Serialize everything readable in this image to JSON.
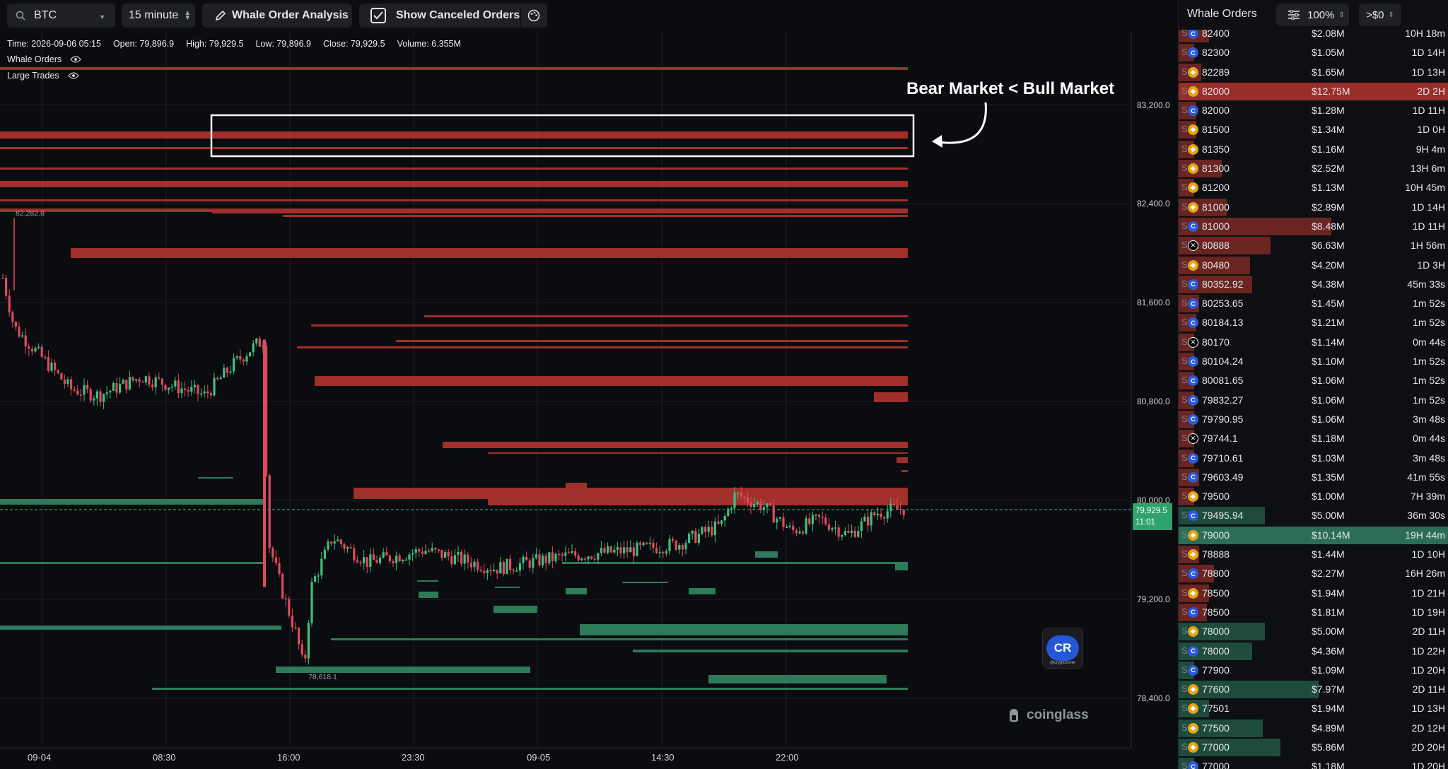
{
  "toolbar": {
    "symbol": "BTC",
    "interval": "15 minute",
    "whale_btn": "Whale Order Analysis",
    "canceled_btn": "Show Canceled Orders"
  },
  "info": {
    "time": "Time: 2026-09-06 05:15",
    "open": "Open: 79,896.9",
    "high": "High: 79,929.5",
    "low": "Low: 79,896.9",
    "close": "Close: 79,929.5",
    "volume": "Volume: 6.355M"
  },
  "legends": {
    "whale": "Whale Orders",
    "large": "Large Trades"
  },
  "annotation": "Bear Market < Bull Market",
  "axis": {
    "prices": [
      "83,200.0",
      "82,400.0",
      "81,600.0",
      "80,800.0",
      "80,000.0",
      "79,200.0",
      "78,400.0"
    ],
    "last_price": "79,929.5",
    "last_countdown": "11:01",
    "times": [
      "09-04",
      "08:30",
      "16:00",
      "23:30",
      "09-05",
      "14:30",
      "22:00"
    ],
    "max_label": "82,282.8",
    "min_label": "78,618.1"
  },
  "branding": {
    "logo": "coinglass",
    "badge": "CR",
    "badge_sub": "@cryptorover"
  },
  "panel": {
    "title": "Whale Orders",
    "percent": "100%",
    "min": ">$0",
    "rows": [
      {
        "side": "S",
        "ex": "C",
        "price": "82400",
        "amount": "$2.08M",
        "age": "10H 18m",
        "bar": 0.12
      },
      {
        "side": "S",
        "ex": "C",
        "price": "82300",
        "amount": "$1.05M",
        "age": "1D 14H",
        "bar": 0.06
      },
      {
        "side": "S",
        "ex": "B",
        "price": "82289",
        "amount": "$1.65M",
        "age": "1D 13H",
        "bar": 0.09
      },
      {
        "side": "S",
        "ex": "B",
        "price": "82000",
        "amount": "$12.75M",
        "age": "2D 2H",
        "bar": 1.0
      },
      {
        "side": "S",
        "ex": "C",
        "price": "82000",
        "amount": "$1.28M",
        "age": "1D 11H",
        "bar": 0.07
      },
      {
        "side": "S",
        "ex": "B",
        "price": "81500",
        "amount": "$1.34M",
        "age": "1D 0H",
        "bar": 0.07
      },
      {
        "side": "S",
        "ex": "B",
        "price": "81350",
        "amount": "$1.16M",
        "age": "9H 4m",
        "bar": 0.06
      },
      {
        "side": "S",
        "ex": "B",
        "price": "81300",
        "amount": "$2.52M",
        "age": "13H 6m",
        "bar": 0.17
      },
      {
        "side": "S",
        "ex": "B",
        "price": "81200",
        "amount": "$1.13M",
        "age": "10H 45m",
        "bar": 0.06
      },
      {
        "side": "S",
        "ex": "B",
        "price": "81000",
        "amount": "$2.89M",
        "age": "1D 14H",
        "bar": 0.19
      },
      {
        "side": "S",
        "ex": "C",
        "price": "81000",
        "amount": "$8.48M",
        "age": "1D 11H",
        "bar": 0.6
      },
      {
        "side": "S",
        "ex": "X",
        "price": "80888",
        "amount": "$6.63M",
        "age": "1H 56m",
        "bar": 0.36
      },
      {
        "side": "S",
        "ex": "B",
        "price": "80480",
        "amount": "$4.20M",
        "age": "1D 3H",
        "bar": 0.28
      },
      {
        "side": "S",
        "ex": "C",
        "price": "80352.92",
        "amount": "$4.38M",
        "age": "45m 33s",
        "bar": 0.29
      },
      {
        "side": "S",
        "ex": "C",
        "price": "80253.65",
        "amount": "$1.45M",
        "age": "1m 52s",
        "bar": 0.08
      },
      {
        "side": "S",
        "ex": "C",
        "price": "80184.13",
        "amount": "$1.21M",
        "age": "1m 52s",
        "bar": 0.07
      },
      {
        "side": "S",
        "ex": "X",
        "price": "80170",
        "amount": "$1.14M",
        "age": "0m 44s",
        "bar": 0.06
      },
      {
        "side": "S",
        "ex": "C",
        "price": "80104.24",
        "amount": "$1.10M",
        "age": "1m 52s",
        "bar": 0.06
      },
      {
        "side": "S",
        "ex": "C",
        "price": "80081.65",
        "amount": "$1.06M",
        "age": "1m 52s",
        "bar": 0.06
      },
      {
        "side": "S",
        "ex": "C",
        "price": "79832.27",
        "amount": "$1.06M",
        "age": "1m 52s",
        "bar": 0.06
      },
      {
        "side": "S",
        "ex": "C",
        "price": "79790.95",
        "amount": "$1.06M",
        "age": "3m 48s",
        "bar": 0.06
      },
      {
        "side": "S",
        "ex": "X",
        "price": "79744.1",
        "amount": "$1.18M",
        "age": "0m 44s",
        "bar": 0.06
      },
      {
        "side": "S",
        "ex": "C",
        "price": "79710.61",
        "amount": "$1.03M",
        "age": "3m 48s",
        "bar": 0.06
      },
      {
        "side": "S",
        "ex": "C",
        "price": "79603.49",
        "amount": "$1.35M",
        "age": "41m 55s",
        "bar": 0.08
      },
      {
        "side": "S",
        "ex": "B",
        "price": "79500",
        "amount": "$1.00M",
        "age": "7H 39m",
        "bar": 0.06
      },
      {
        "side": "S",
        "ex": "C",
        "price": "79495.94",
        "amount": "$5.00M",
        "age": "36m 30s",
        "bar": 0.34
      },
      {
        "side": "B",
        "ex": "B",
        "price": "79000",
        "amount": "$10.14M",
        "age": "19H 44m",
        "bar": 1.0
      },
      {
        "side": "S",
        "ex": "B",
        "price": "78888",
        "amount": "$1.44M",
        "age": "1D 10H",
        "bar": 0.08
      },
      {
        "side": "S",
        "ex": "C",
        "price": "78800",
        "amount": "$2.27M",
        "age": "16H 26m",
        "bar": 0.14
      },
      {
        "side": "S",
        "ex": "B",
        "price": "78500",
        "amount": "$1.94M",
        "age": "1D 21H",
        "bar": 0.12
      },
      {
        "side": "S",
        "ex": "C",
        "price": "78500",
        "amount": "$1.81M",
        "age": "1D 19H",
        "bar": 0.11
      },
      {
        "side": "S",
        "ex": "B",
        "price": "78000",
        "amount": "$5.00M",
        "age": "2D 11H",
        "bar": 0.34
      },
      {
        "side": "S",
        "ex": "C",
        "price": "78000",
        "amount": "$4.36M",
        "age": "1D 22H",
        "bar": 0.29
      },
      {
        "side": "S",
        "ex": "C",
        "price": "77900",
        "amount": "$1.09M",
        "age": "1D 20H",
        "bar": 0.06
      },
      {
        "side": "S",
        "ex": "B",
        "price": "77600",
        "amount": "$7.97M",
        "age": "2D 11H",
        "bar": 0.55
      },
      {
        "side": "S",
        "ex": "B",
        "price": "77501",
        "amount": "$1.94M",
        "age": "1D 13H",
        "bar": 0.12
      },
      {
        "side": "S",
        "ex": "B",
        "price": "77500",
        "amount": "$4.89M",
        "age": "2D 12H",
        "bar": 0.33
      },
      {
        "side": "S",
        "ex": "B",
        "price": "77000",
        "amount": "$5.86M",
        "age": "2D 20H",
        "bar": 0.4
      },
      {
        "side": "S",
        "ex": "C",
        "price": "77000",
        "amount": "$1.18M",
        "age": "1D 20H",
        "bar": 0.06
      }
    ]
  },
  "colors": {
    "sell": "#b2322c",
    "buy": "#2f7a5a",
    "candle_up": "#3fbf7f",
    "candle_down": "#e04a5f",
    "coinbase": "#2b5bd9",
    "binance": "#e6a317",
    "okx": "#ffffff"
  }
}
